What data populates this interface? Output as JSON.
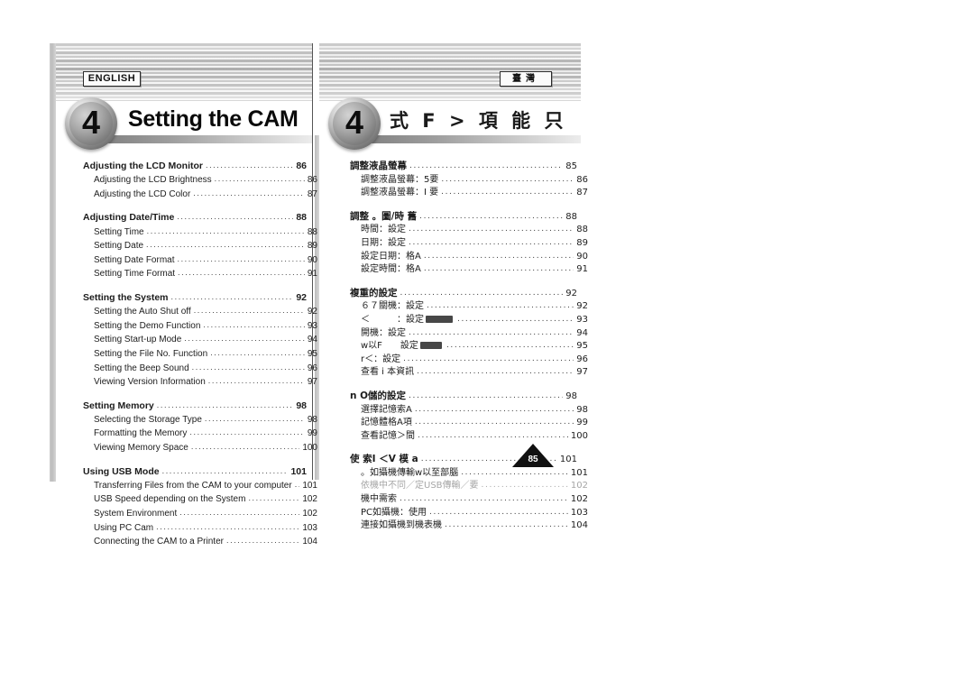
{
  "page": {
    "number": "85",
    "chapter_number": "4"
  },
  "left": {
    "language_badge": "ENGLISH",
    "chapter_title": "Setting the CAM",
    "toc": [
      {
        "level": 1,
        "label": "Adjusting the LCD Monitor",
        "page": "86"
      },
      {
        "level": 2,
        "label": "Adjusting the LCD Brightness",
        "page": "86"
      },
      {
        "level": 2,
        "label": "Adjusting the LCD Color",
        "page": "87"
      },
      {
        "level": 0,
        "label": "",
        "page": ""
      },
      {
        "level": 1,
        "label": "Adjusting Date/Time",
        "page": "88"
      },
      {
        "level": 2,
        "label": "Setting Time",
        "page": "88"
      },
      {
        "level": 2,
        "label": "Setting Date",
        "page": "89"
      },
      {
        "level": 2,
        "label": "Setting Date Format",
        "page": "90"
      },
      {
        "level": 2,
        "label": "Setting Time Format",
        "page": "91"
      },
      {
        "level": 0,
        "label": "",
        "page": ""
      },
      {
        "level": 1,
        "label": "Setting the System",
        "page": "92"
      },
      {
        "level": 2,
        "label": "Setting the Auto Shut off",
        "page": "92"
      },
      {
        "level": 2,
        "label": "Setting the Demo Function",
        "page": "93"
      },
      {
        "level": 2,
        "label": "Setting Start-up Mode",
        "page": "94"
      },
      {
        "level": 2,
        "label": "Setting the File No. Function",
        "page": "95"
      },
      {
        "level": 2,
        "label": "Setting the Beep Sound",
        "page": "96"
      },
      {
        "level": 2,
        "label": "Viewing Version Information",
        "page": "97"
      },
      {
        "level": 0,
        "label": "",
        "page": ""
      },
      {
        "level": 1,
        "label": "Setting Memory",
        "page": "98"
      },
      {
        "level": 2,
        "label": "Selecting the Storage Type",
        "page": "98"
      },
      {
        "level": 2,
        "label": "Formatting the Memory",
        "page": "99"
      },
      {
        "level": 2,
        "label": "Viewing Memory Space",
        "page": "100"
      },
      {
        "level": 0,
        "label": "",
        "page": ""
      },
      {
        "level": 1,
        "label": "Using USB Mode",
        "page": "101"
      },
      {
        "level": 2,
        "label": "Transferring Files from the CAM to your computer",
        "page": "101"
      },
      {
        "level": 2,
        "label": "USB Speed depending on the System",
        "page": "102"
      },
      {
        "level": 2,
        "label": "System Environment",
        "page": "102"
      },
      {
        "level": 2,
        "label": "Using PC Cam",
        "page": "103"
      },
      {
        "level": 2,
        "label": "Connecting the CAM to a Printer",
        "page": "104"
      }
    ]
  },
  "right": {
    "language_badge": "臺灣",
    "chapter_title": "式 F > 項 能 只",
    "toc": [
      {
        "level": 1,
        "label": "調整液晶螢幕",
        "page": "85"
      },
      {
        "level": 2,
        "label": "調整液晶螢幕：5要",
        "page": "86"
      },
      {
        "level": 2,
        "label": "調整液晶螢幕：I 要",
        "page": "87"
      },
      {
        "level": 0,
        "label": "",
        "page": ""
      },
      {
        "level": 1,
        "label": "調整 。圖/時 舊",
        "page": "88"
      },
      {
        "level": 2,
        "label": "時間：設定",
        "page": "88"
      },
      {
        "level": 2,
        "label": "日期：設定",
        "page": "89"
      },
      {
        "level": 2,
        "label": "設定日期：格A",
        "page": "90"
      },
      {
        "level": 2,
        "label": "設定時間：格A",
        "page": "91"
      },
      {
        "level": 0,
        "label": "",
        "page": ""
      },
      {
        "level": 1,
        "label": "複重的設定",
        "page": "92"
      },
      {
        "level": 2,
        "label": "６７關機：設定",
        "page": "92"
      },
      {
        "level": 2,
        "label": "＜　　　：設定",
        "page": "93",
        "smudge": "after-1"
      },
      {
        "level": 2,
        "label": "開機：設定",
        "page": "94"
      },
      {
        "level": 2,
        "label": "w以F　　設定",
        "page": "95",
        "smudge": "mid"
      },
      {
        "level": 2,
        "label": "r＜：設定",
        "page": "96"
      },
      {
        "level": 2,
        "label": "查看 i 本資訊",
        "page": "97"
      },
      {
        "level": 0,
        "label": "",
        "page": ""
      },
      {
        "level": 1,
        "label": "n O儲的設定",
        "page": "98"
      },
      {
        "level": 2,
        "label": "選擇記憶索A",
        "page": "98"
      },
      {
        "level": 2,
        "label": "記憶體格A項",
        "page": "99"
      },
      {
        "level": 2,
        "label": "查看記憶＞間",
        "page": "100"
      },
      {
        "level": 0,
        "label": "",
        "page": ""
      },
      {
        "level": 1,
        "label": "使 索I ＜V 模 a",
        "page": "101"
      },
      {
        "level": 2,
        "label": "。如攝機傳輸w以至部腦",
        "page": "101"
      },
      {
        "level": 2,
        "label": "依機中不同／定USB傳輸／要",
        "page": "102",
        "faded": true
      },
      {
        "level": 2,
        "label": "機中需索",
        "page": "102"
      },
      {
        "level": 2,
        "label": "PC如攝機：使用",
        "page": "103"
      },
      {
        "level": 2,
        "label": "連接如攝機到機表機",
        "page": "104"
      }
    ]
  }
}
